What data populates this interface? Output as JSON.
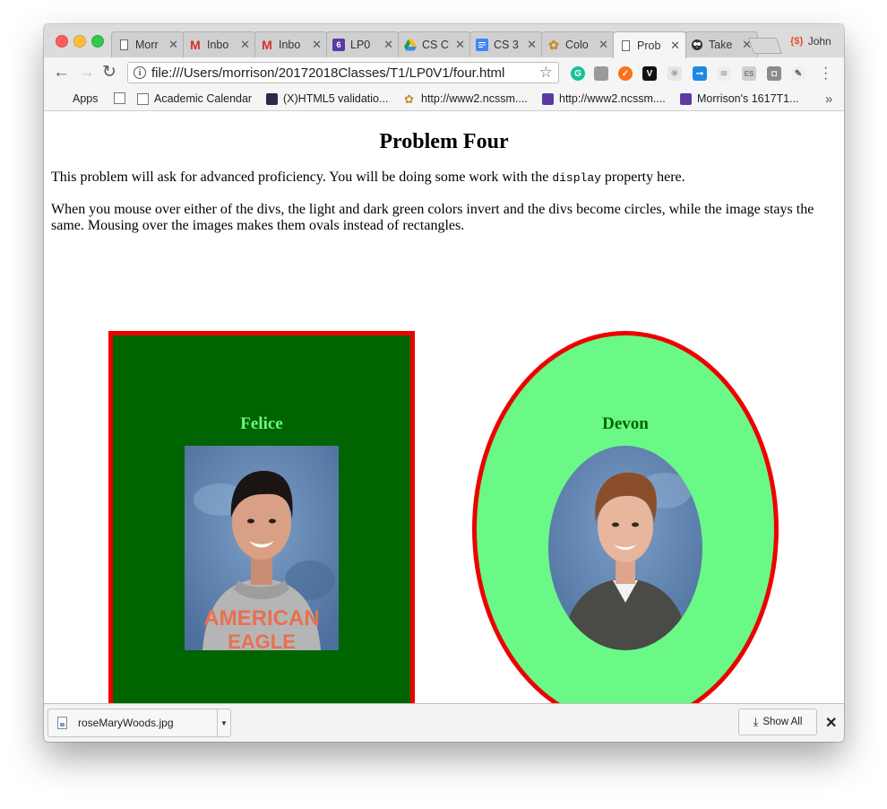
{
  "browser": {
    "tabs": [
      {
        "label": "Morr",
        "icon": "page-icon"
      },
      {
        "label": "Inbo",
        "icon": "gmail-icon"
      },
      {
        "label": "Inbo",
        "icon": "gmail-icon"
      },
      {
        "label": "LP0",
        "icon": "lp-favicon-icon"
      },
      {
        "label": "CS C",
        "icon": "google-drive-icon"
      },
      {
        "label": "CS 3",
        "icon": "google-docs-icon"
      },
      {
        "label": "Colo",
        "icon": "color-wheel-icon"
      },
      {
        "label": "Prob",
        "icon": "page-icon"
      },
      {
        "label": "Take",
        "icon": "owl-icon"
      }
    ],
    "profile_name": "John",
    "address": "file:///Users/morrison/20172018Classes/T1/LP0V1/four.html",
    "bookmarks": [
      {
        "label": "Apps"
      },
      {
        "label": ""
      },
      {
        "label": "Academic Calendar"
      },
      {
        "label": "(X)HTML5 validatio..."
      },
      {
        "label": "http://www2.ncssm...."
      },
      {
        "label": "http://www2.ncssm...."
      },
      {
        "label": "Morrison's 1617T1..."
      }
    ]
  },
  "page": {
    "heading": "Problem Four",
    "intro_before": "This problem will ask for advanced proficiency. You will be doing some work with the ",
    "intro_code": "display",
    "intro_after": " property here.",
    "instructions": "When you mouse over either of the divs, the light and dark green colors invert and the divs become circles, while the image stays the same. Mousing over the images makes them ovals instead of rectangles.",
    "cards": [
      {
        "name": "Felice",
        "shape": "rectangle",
        "background": "#006400",
        "text_color": "#6af887"
      },
      {
        "name": "Devon",
        "shape": "oval",
        "background": "#6af887",
        "text_color": "#006400"
      }
    ],
    "border_color": "#ee0000"
  },
  "downloads": {
    "file_name": "roseMaryWoods.jpg",
    "show_all_label": "Show All"
  }
}
